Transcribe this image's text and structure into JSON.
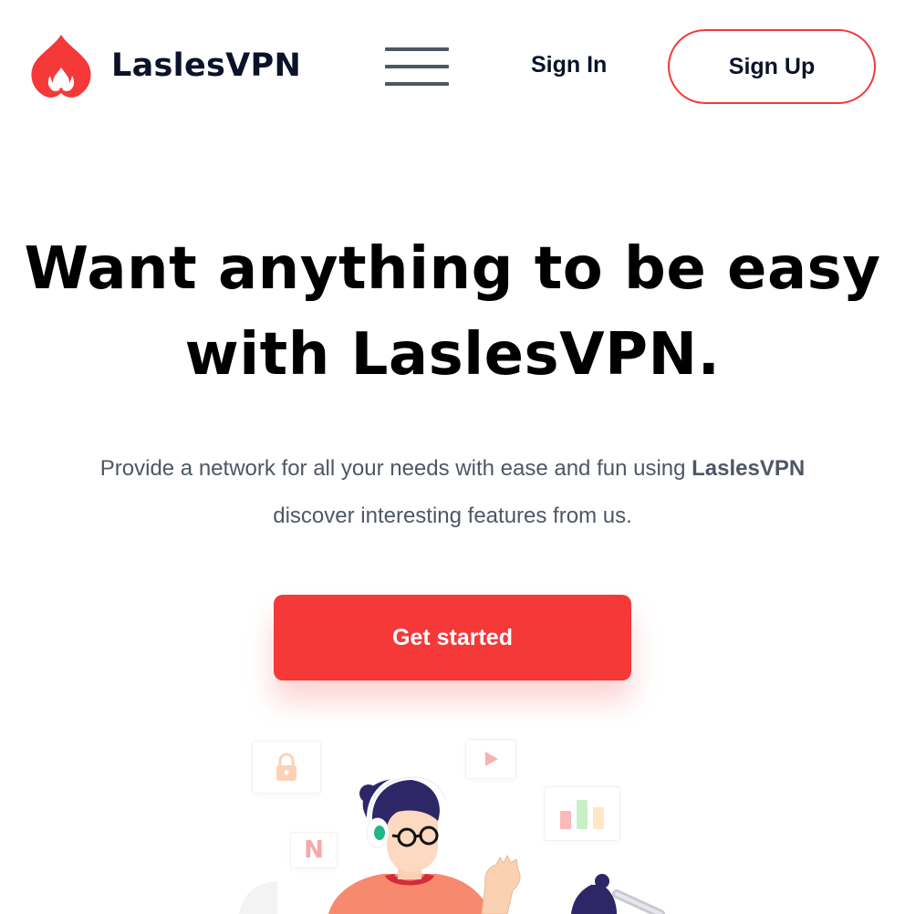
{
  "brand": {
    "name_part1": "Lasles",
    "name_part2": "VPN",
    "logo_icon": "flame-icon",
    "accent_color": "#F53838",
    "text_color": "#0B132A",
    "muted_color": "#4F5665"
  },
  "nav": {
    "menu_icon": "hamburger-menu-icon",
    "signin_label": "Sign In",
    "signup_label": "Sign Up"
  },
  "hero": {
    "title_line1": "Want anything to be easy",
    "title_line2_prefix": "with ",
    "title_line2_brand": "LaslesVPN.",
    "subtitle_line1_prefix": "Provide a network for all your needs with ease and fun using ",
    "subtitle_line1_brand": "LaslesVPN",
    "subtitle_line2": "discover interesting features from us.",
    "cta_label": "Get started"
  },
  "illustration": {
    "cards": [
      "lock-icon",
      "play-icon",
      "bar-chart-icon",
      "netflix-n-icon"
    ],
    "netflix_letter": "N",
    "person": "person-with-headphones-illustration"
  }
}
